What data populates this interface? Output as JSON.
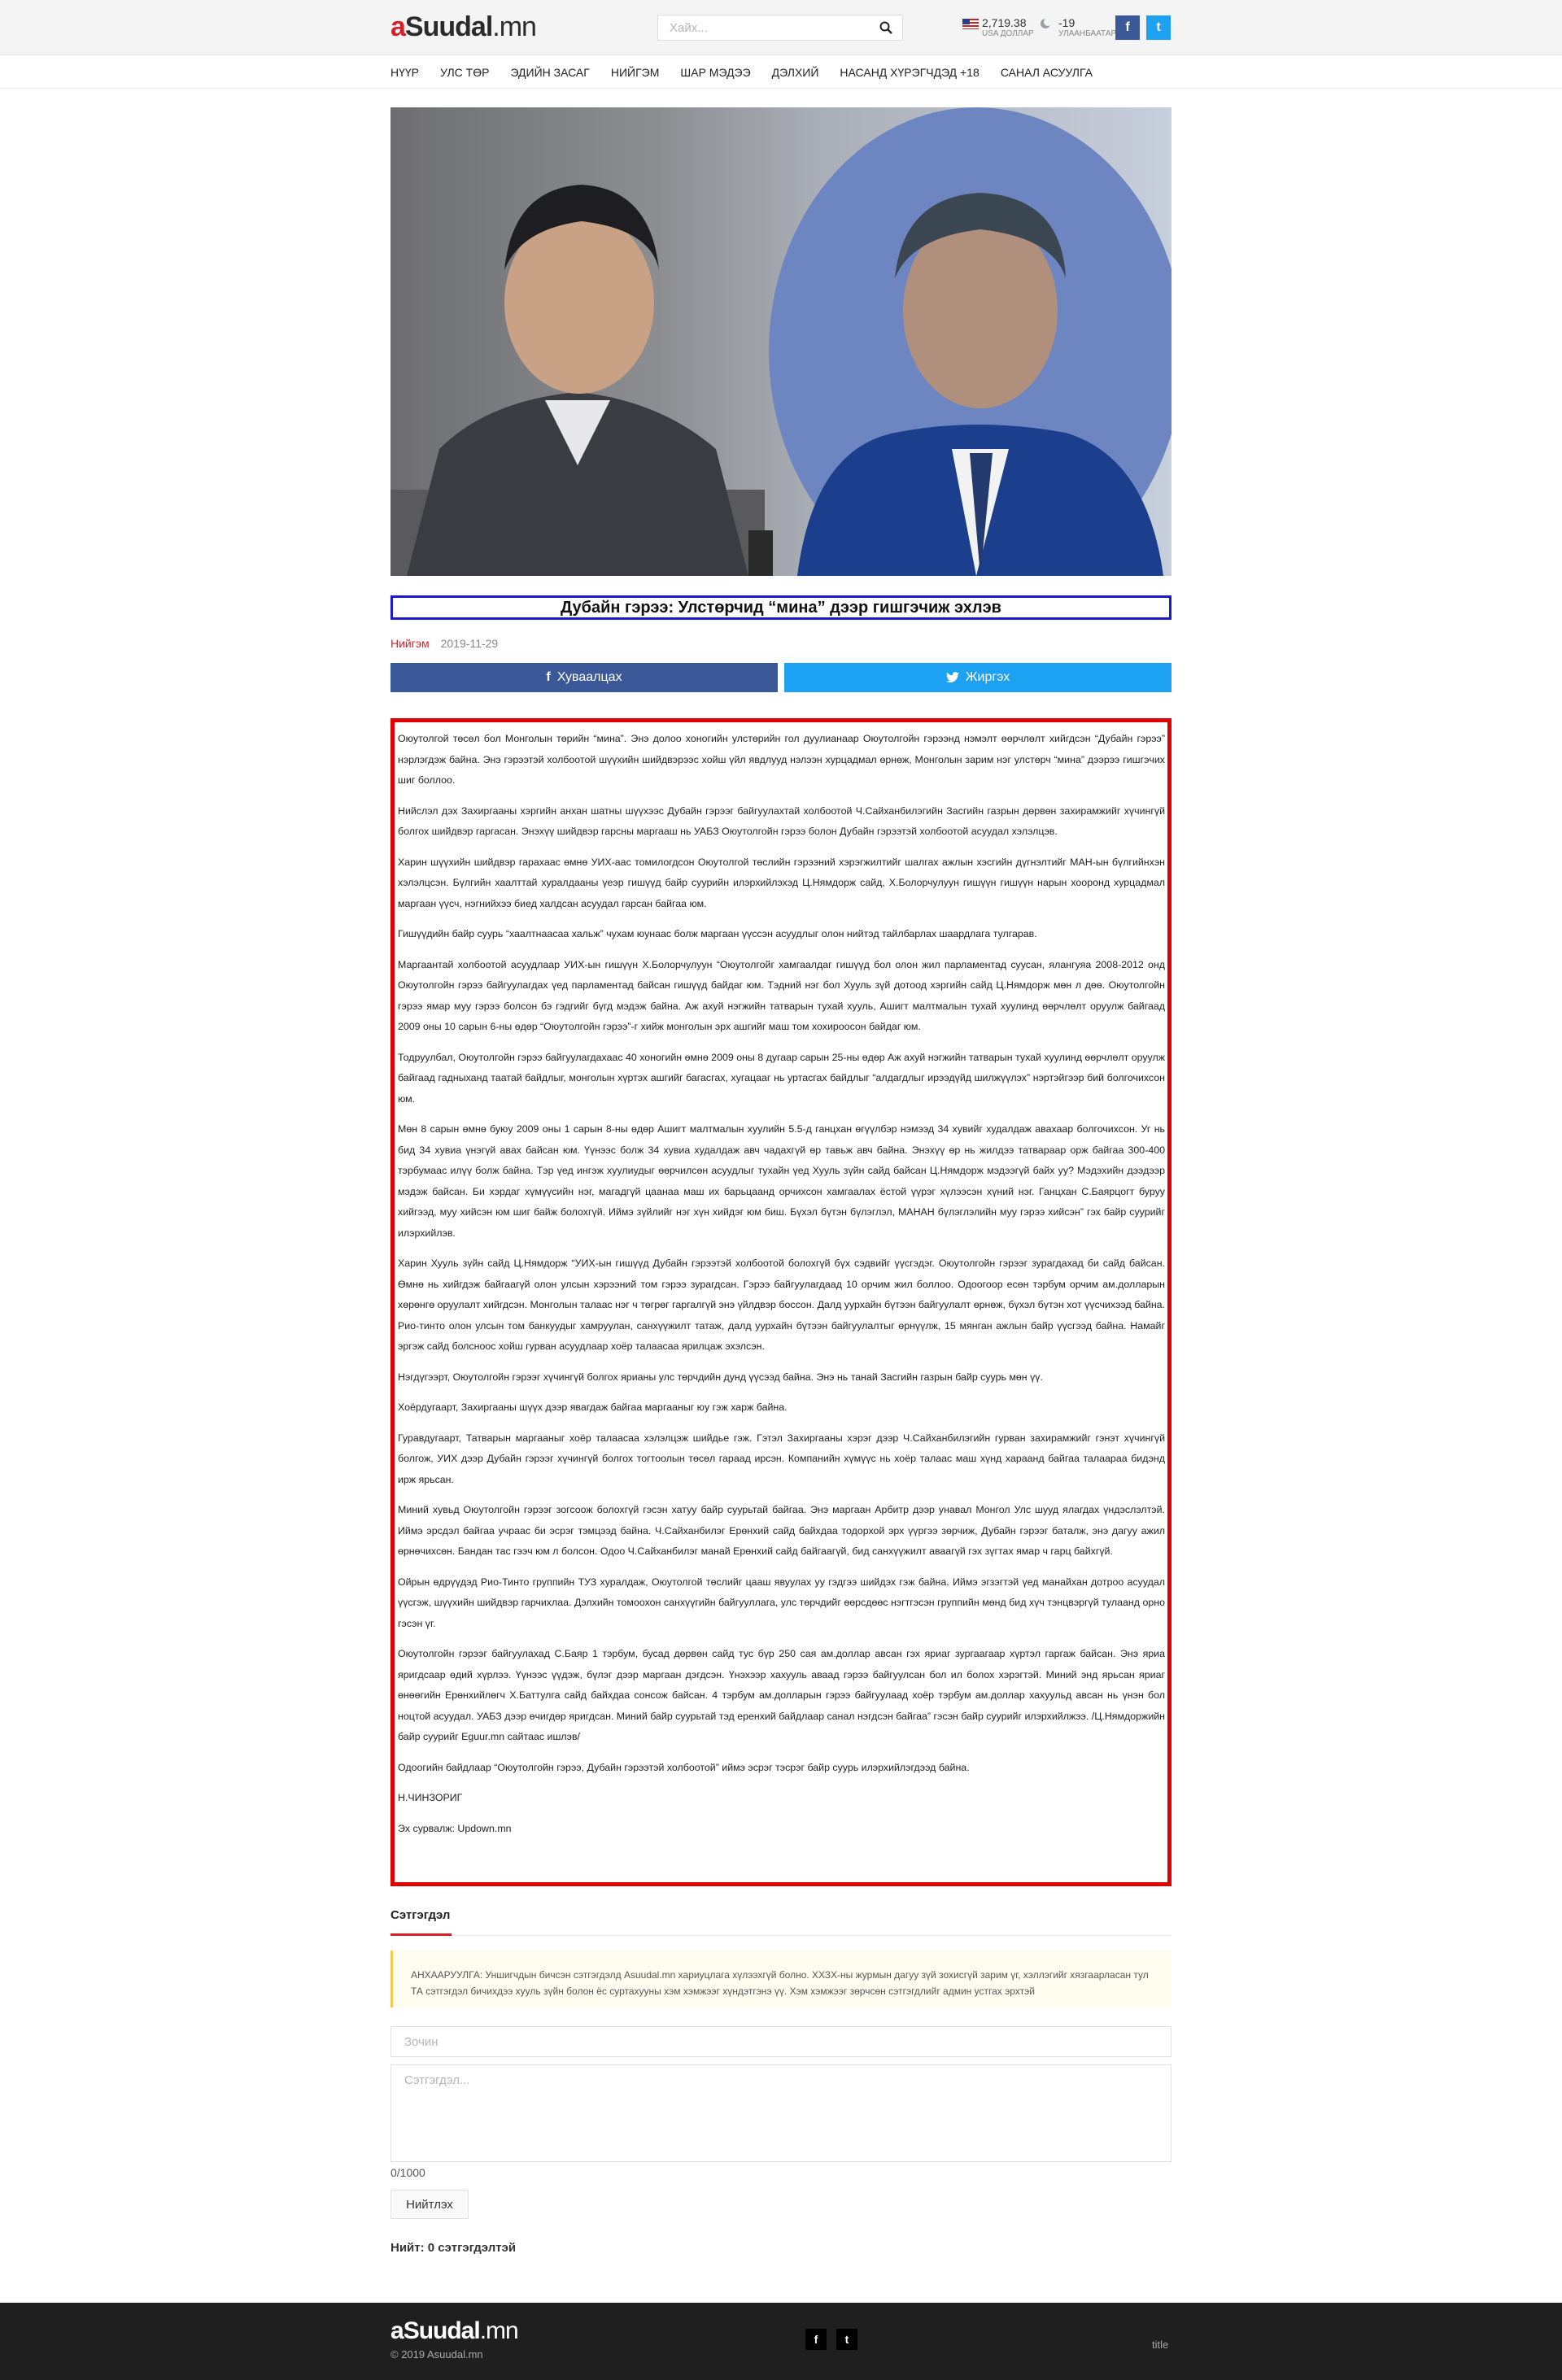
{
  "header": {
    "logo_a": "a",
    "logo_rest": "Suudal",
    "logo_tld": ".mn",
    "search_placeholder": "Хайх...",
    "currency_value": "2,719.38",
    "currency_label": "USA ДОЛЛАР",
    "weather_value": "-19",
    "weather_label": "УЛААНБААТАР",
    "facebook_glyph": "f",
    "twitter_glyph": "t"
  },
  "nav": {
    "items": [
      "НҮҮР",
      "УЛС ТӨР",
      "ЭДИЙН ЗАСАГ",
      "НИЙГЭМ",
      "ШАР МЭДЭЭ",
      "ДЭЛХИЙ",
      "НАСАНД ХҮРЭГЧДЭД +18",
      "САНАЛ АСУУЛГА"
    ]
  },
  "article": {
    "title": "Дубайн гэрээ: Улстөрчид “мина” дээр гишгэчиж эхлэв",
    "category": "Нийгэм",
    "date": "2019-11-29",
    "share_facebook": "Хуваалцах",
    "share_twitter": "Жиргэх",
    "paragraphs": [
      "Оюутолгой төсөл бол Монголын төрийн “мина”. Энэ долоо хоногийн улстөрийн гол дуулианаар Оюутолгойн гэрээнд нэмэлт өөрчлөлт хийгдсэн “Дубайн гэрээ” нэрлэгдэж байна. Энэ гэрээтэй холбоотой шүүхийн шийдвэрээс хойш үйл явдлууд нэлээн хурцадмал өрнөж, Монголын зарим нэг улстөрч “мина” дээрээ гишгэчих шиг боллоо.",
      "Нийслэл дэх Захиргааны хэргийн анхан шатны шүүхээс Дубайн гэрээг байгуулахтай холбоотой Ч.Сайханбилэгийн Засгийн газрын дөрвөн захирамжийг хүчингүй болгох шийдвэр гаргасан. Энэхүү шийдвэр гарсны маргааш нь УАБЗ Оюутолгойн гэрээ болон Дубайн гэрээтэй холбоотой асуудал хэлэлцэв.",
      "Харин шүүхийн шийдвэр гарахаас өмнө УИХ-аас томилогдсон Оюутолгой төслийн гэрээний хэрэгжилтийг шалгах ажлын хэсгийн дүгнэлтийг МАН-ын бүлгийнхэн хэлэлцсэн. Бүлгийн хаалттай хуралдааны үеэр гишүүд байр суурийн илэрхийлэхэд Ц.Нямдорж сайд, Х.Болорчулуун гишүүн гишүүн нарын хооронд хурцадмал маргаан үүсч, нэгнийхээ биед халдсан асуудал гарсан байгаа юм.",
      "Гишүүдийн байр суурь “хаалтнаасаа хальж” чухам юунаас болж маргаан үүссэн асуудлыг олон нийтэд тайлбарлах шаардлага тулгарав.",
      "Маргаантай холбоотой асуудлаар УИХ-ын гишүүн Х.Болорчулуун “Оюутолгойг хамгаалдаг гишүүд бол олон жил парламентад суусан, ялангуяа 2008-2012 онд Оюутолгойн гэрээ байгуулагдах үед парламентад  байсан гишүүд байдаг юм. Тэдний нэг бол Хууль зүй дотоод хэргийн сайд Ц.Нямдорж мөн л дөө. Оюутолгойн гэрээ ямар муу гэрээ болсон бэ гэдгийг бүгд мэдэж байна. Аж ахуй нэгжийн татварын тухай хууль, Ашигт малтмалын тухай хуулинд өөрчлөлт оруулж байгаад 2009 оны 10 сарын 6-ны өдөр “Оюутолгойн гэрээ”-г хийж монголын эрх ашгийг маш том хохироосон байдаг юм.",
      "Тодруулбал, Оюутолгойн гэрээ байгуулагдахаас 40 хоногийн өмнө 2009 оны 8 дугаар сарын 25-ны өдөр Аж ахуй нэгжийн татварын тухай хуулинд өөрчлөлт оруулж байгаад гадныханд таатай байдлыг, монголын хүртэх ашгийг багасгах, хугацааг нь уртасгах байдлыг “алдагдлыг ирээдүйд шилжүүлэх” нэртэйгээр бий болгочихсон юм.",
      "Мөн 8 сарын өмнө буюу 2009 оны 1 сарын 8-ны өдөр Ашигт малтмалын хуулийн 5.5-д ганцхан өгүүлбэр нэмээд 34 хувийг  худалдаж авахаар болгочихсон. Уг нь бид 34 хувиа үнэгүй авах байсан юм. Үүнээс болж 34 хувиа худалдаж авч чадахгүй өр тавьж авч байна. Энэхүү өр нь жилдээ татвараар орж байгаа 300-400 тэрбумаас илүү болж байна. Тэр үед ингэж хуулиудыг өөрчилсөн асуудлыг тухайн үед Хууль зүйн сайд байсан Ц.Нямдорж мэдээгүй байх уу? Мэдэхийн дээдээр мэдэж байсан. Би хэрдаг хүмүүсийн нэг, магадгүй цаанаа маш их барьцаанд орчихсон хамгаалах ёстой үүрэг хүлээсэн хүний нэг. Ганцхан С.Баярцогт буруу хийгээд, муу хийсэн юм шиг байж болохгүй. Иймэ зүйлийг нэг хүн хийдэг юм биш. Бүхэл бүтэн бүлэглэл, МАНАН бүлэглэлийн муу гэрээ хийсэн” гэх байр суурийг илэрхийлэв.",
      "Харин Хууль зүйн сайд Ц.Нямдорж “УИХ-ын гишүүд Дубайн гэрээтэй холбоотой болохгүй бүх сэдвийг үүсгэдэг. Оюутолгойн гэрээг зурагдахад би сайд байсан. Өмнө нь хийгдэж байгаагүй олон улсын хэрээний том гэрээ зурагдсан. Гэрээ байгуулагдаад 10 орчим жил боллоо. Одоогоор есөн тэрбум орчим ам.долларын хөрөнгө оруулалт хийгдсэн. Монголын талаас нэг ч төгрөг гаргалгүй энэ үйлдвэр боссон. Далд уурхайн бүтээн байгуулалт өрнөж, бүхэл бүтэн хот үүсчихээд байна. Рио-тинто олон улсын том банкуудыг хамруулан, санхүүжилт татаж, далд уурхайн бүтээн байгуулалтыг өрнүүлж, 15 мянган ажлын байр үүсгээд байна. Намайг эргэж сайд болсноос хойш гурван асуудлаар хоёр талаасаа ярилцаж эхэлсэн.",
      "Нэгдүгээрт, Оюутолгойн гэрээг хүчингүй болгох ярианы улс төрчдийн дунд үүсээд байна. Энэ нь танай Засгийн газрын байр суурь мөн үү.",
      "Хоёрдугаарт, Захиргааны шүүх дээр явагдаж байгаа маргааныг юу гэж харж байна.",
      "Гуравдугаарт, Татварын маргааныг хоёр талаасаа хэлэлцэж шийдье гэж. Гэтэл Захиргааны хэрэг дээр Ч.Сайханбилэгийн гурван захирамжийг гэнэт хүчингүй болгож, УИХ дээр Дубайн гэрээг хүчингүй болгох тогтоолын төсөл гараад ирсэн. Компанийн хүмүүс нь хоёр талаас маш хүнд хараанд байгаа талаараа бидэнд ирж ярьсан.",
      "Миний хувьд Оюутолгойн гэрээг зогсоож болохгүй гэсэн хатуу байр суурьтай байгаа. Энэ маргаан Арбитр дээр унавал Монгол Улс шууд ялагдах үндэслэлтэй. Иймэ эрсдэл байгаа учраас би эсрэг тэмцээд байна. Ч.Сайханбилэг Ерөнхий сайд байхдаа тодорхой эрх үүргээ зөрчиж, Дубайн гэрээг баталж, энэ дагуу ажил өрнөчихсөн. Бандан тас гээч юм л болсон. Одоо Ч.Сайханбилэг манай Ерөнхий сайд байгаагүй, бид санхүүжилт аваагүй гэх зүгтах ямар ч гарц байхгүй.",
      "Ойрын өдрүүдэд Рио-Тинто группийн ТУЗ хуралдаж, Оюутолгой төслийг цааш явуулах уу гэдгээ шийдэх гэж байна. Иймэ эгзэгтэй үед манайхан дотроо асуудал үүсгэж, шүүхийн шийдвэр гарчихлаа. Дэлхийн томоохон санхүүгийн байгууллага, улс төрчдийг өөрсдөөс нэгтгэсэн группийн мөнд бид хүч тэнцвэргүй тулаанд орно гэсэн үг.",
      "Оюутолгойн гэрээг байгуулахад С.Баяр 1 тэрбум, бусад дөрвөн сайд тус бүр 250 сая ам.доллар авсан гэх яриаг зургаагаар хүртэл гаргаж байсан. Энэ яриа яригдсаар өдий хүрлээ. Үүнээс үүдэж, бүлэг дээр маргаан дэгдсэн. Үнэхээр хахууль аваад гэрээ байгуулсан бол ил болох хэрэгтэй. Миний энд ярьсан яриаг өнөөгийн Ерөнхийлөгч Х.Баттулга сайд байхдаа сонсож байсан. 4 тэрбум ам.долларын гэрээ байгуулаад хоёр тэрбум ам.доллар хахуульд авсан нь үнэн бол ноцтой асуудал. УАБЗ дээр өчигдөр яригдсан. Миний байр суурьтай тэд еренхий байдлаар санал нэгдсэн байгаа” гэсэн байр суурийг илэрхийлжээ. /Ц.Нямдоржийн байр суурийг Eguur.mn сайтаас ишлэв/",
      "Одоогийн байдлаар “Оюутолгойн гэрээ, Дубайн гэрээтэй холбоотой” иймэ эсрэг тэсрэг байр суурь илэрхийлэгдээд байна.",
      "Н.ЧИНЗОРИГ",
      "Эх сурвалж: Updown.mn"
    ]
  },
  "comments": {
    "tab_label": "Сэтгэгдэл",
    "notice": "АНХААРУУЛГА: Уншигчдын бичсэн сэтгэгдэлд Asuudal.mn хариуцлага хүлээхгүй болно. ХХЗХ-ны журмын дагуу зүй зохисгүй зарим үг, хэллэгийг хязгаарласан тул ТА сэтгэгдэл бичихдээ хууль зүйн болон ёс суртахууны хэм хэмжээг хүндэтгэнэ үү. Хэм хэмжээг зөрчсөн сэтгэгдлийг админ устгах эрхтэй",
    "name_placeholder": "Зочин",
    "comment_placeholder": "Сэтгэгдэл...",
    "counter": "0/1000",
    "submit_label": "Нийтлэх",
    "total_label": "Нийт: 0 сэтгэгдэлтэй"
  },
  "footer": {
    "logo_a": "a",
    "logo_rest": "Suudal",
    "logo_tld": ".mn",
    "copyright": "© 2019 Asuudal.mn",
    "facebook_glyph": "f",
    "twitter_glyph": "t",
    "title": "title"
  },
  "colors": {
    "brand_red": "#d81f26",
    "facebook_blue": "#3b5998",
    "twitter_blue": "#1da1f2",
    "title_border": "#1a1acc",
    "article_border": "#e00000"
  },
  "icons": [
    "search-icon",
    "us-flag-icon",
    "weather-icon",
    "facebook-icon",
    "twitter-icon"
  ]
}
